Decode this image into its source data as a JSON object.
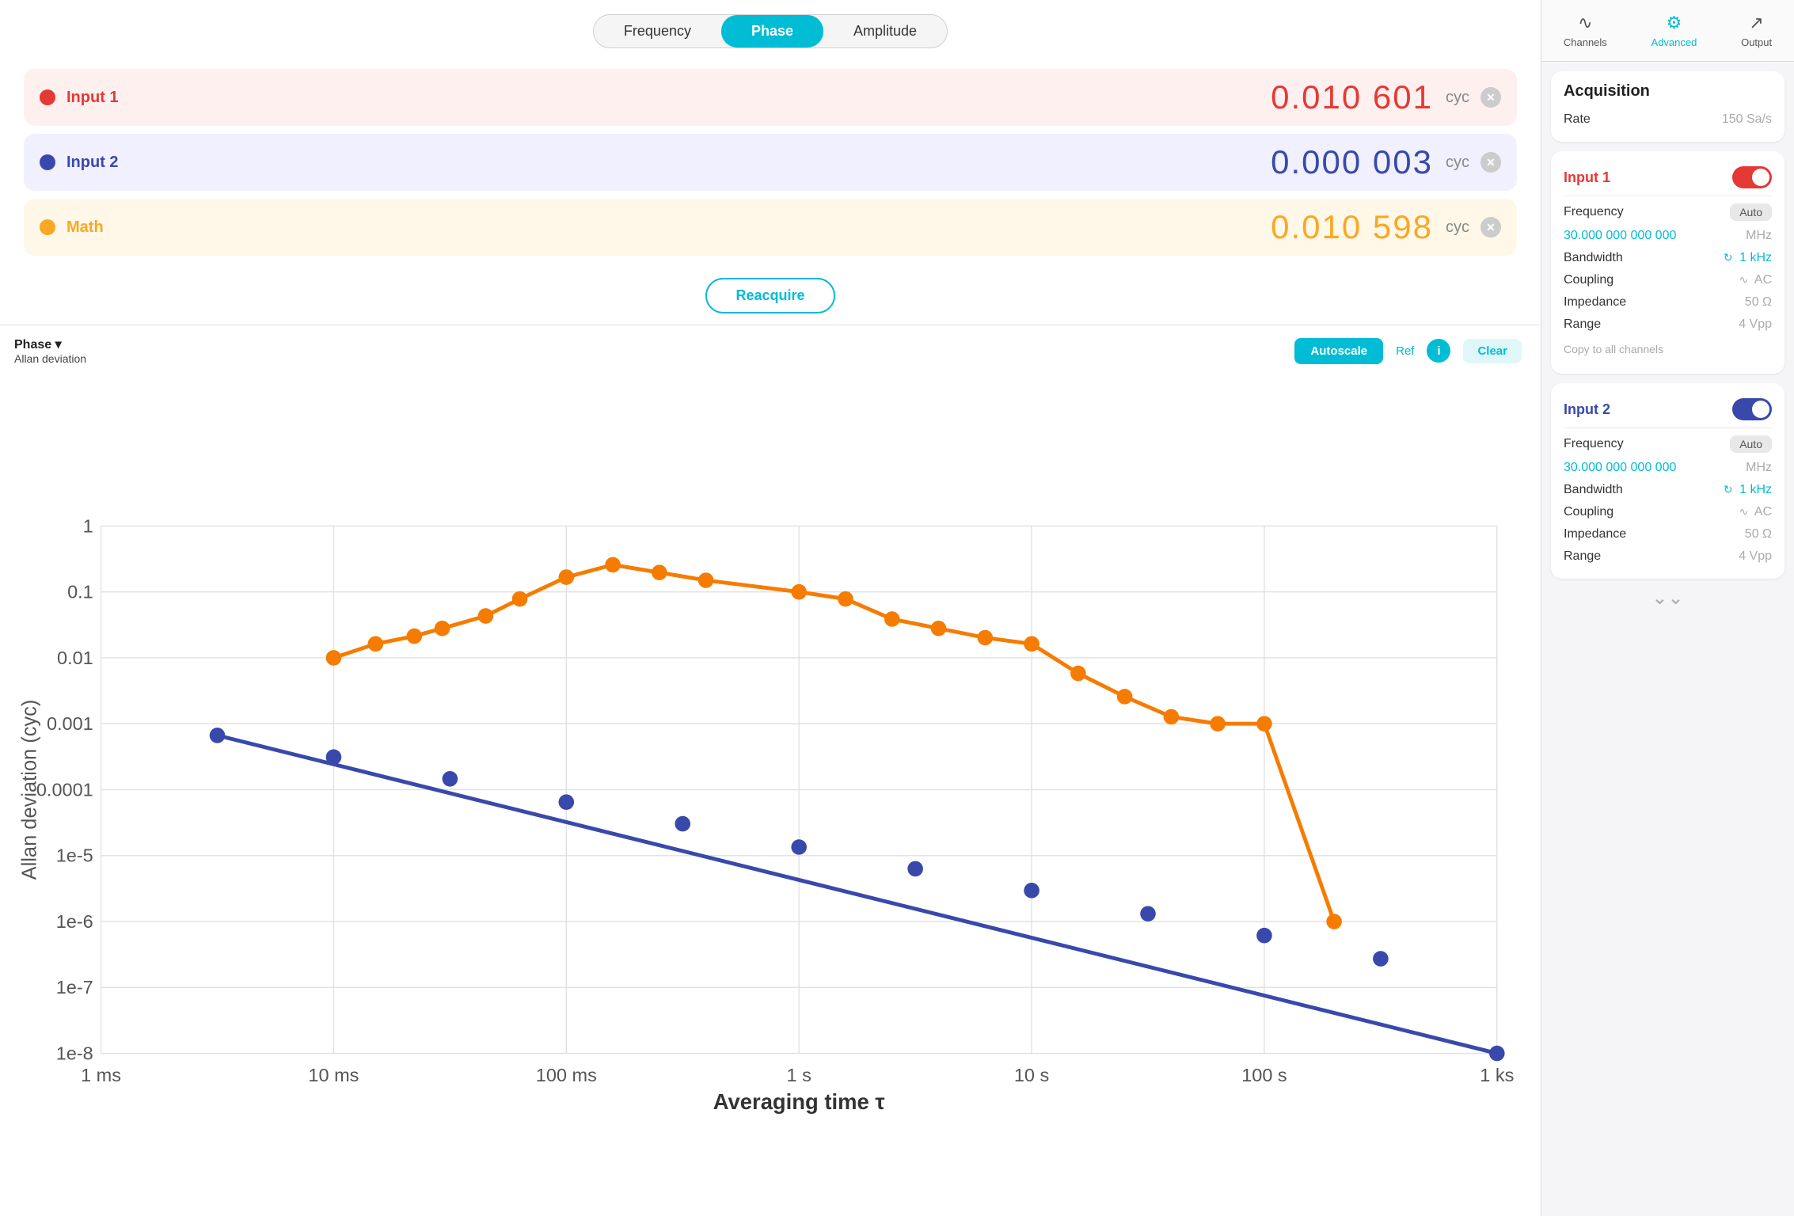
{
  "tabs": {
    "items": [
      {
        "label": "Frequency"
      },
      {
        "label": "Phase"
      },
      {
        "label": "Amplitude"
      }
    ],
    "active": 1
  },
  "measurements": [
    {
      "id": "input1",
      "label": "Input 1",
      "dot_color": "dot-red",
      "value": "0.010 601",
      "unit": "cyc",
      "row_class": "input1"
    },
    {
      "id": "input2",
      "label": "Input 2",
      "dot_color": "dot-blue",
      "value": "0.000 003",
      "unit": "cyc",
      "row_class": "input2"
    },
    {
      "id": "math",
      "label": "Math",
      "dot_color": "dot-gold",
      "value": "0.010 598",
      "unit": "cyc",
      "row_class": "math"
    }
  ],
  "reacquire": {
    "label": "Reacquire"
  },
  "chart": {
    "title_line1": "Phase ▾",
    "title_line2": "Allan deviation",
    "autoscale_label": "Autoscale",
    "ref_label": "Ref",
    "info_label": "i",
    "clear_label": "Clear",
    "y_axis_label": "Allan deviation (cyc)",
    "x_axis_label": "Averaging time τ",
    "y_ticks": [
      "1",
      "0.1",
      "0.01",
      "0.001",
      "0.0001",
      "1e-5",
      "1e-6",
      "1e-7",
      "1e-8"
    ],
    "x_ticks": [
      "1 ms",
      "10 ms",
      "100 ms",
      "1 s",
      "10 s",
      "100 s",
      "1 ks"
    ]
  },
  "sidebar": {
    "nav_items": [
      {
        "label": "Channels",
        "icon": "∿",
        "active": false
      },
      {
        "label": "Advanced",
        "icon": "⚙",
        "active": true
      },
      {
        "label": "Output",
        "icon": "↗",
        "active": false
      }
    ],
    "acquisition": {
      "title": "Acquisition",
      "rate_label": "Rate",
      "rate_value": "150 Sa/s"
    },
    "input1": {
      "section_title": "Input 1",
      "toggle_class": "on-red",
      "frequency_label": "Frequency",
      "frequency_badge": "Auto",
      "frequency_value": "30.000 000 000 000",
      "frequency_unit": "MHz",
      "bandwidth_label": "Bandwidth",
      "bandwidth_value": "1 kHz",
      "coupling_label": "Coupling",
      "coupling_value": "AC",
      "impedance_label": "Impedance",
      "impedance_value": "50 Ω",
      "range_label": "Range",
      "range_value": "4 Vpp",
      "copy_label": "Copy to all channels"
    },
    "input2": {
      "section_title": "Input 2",
      "toggle_class": "on-blue",
      "frequency_label": "Frequency",
      "frequency_badge": "Auto",
      "frequency_value": "30.000 000 000 000",
      "frequency_unit": "MHz",
      "bandwidth_label": "Bandwidth",
      "bandwidth_value": "1 kHz",
      "coupling_label": "Coupling",
      "coupling_value": "AC",
      "impedance_label": "Impedance",
      "impedance_value": "50 Ω",
      "range_label": "Range",
      "range_value": "4 Vpp"
    }
  }
}
